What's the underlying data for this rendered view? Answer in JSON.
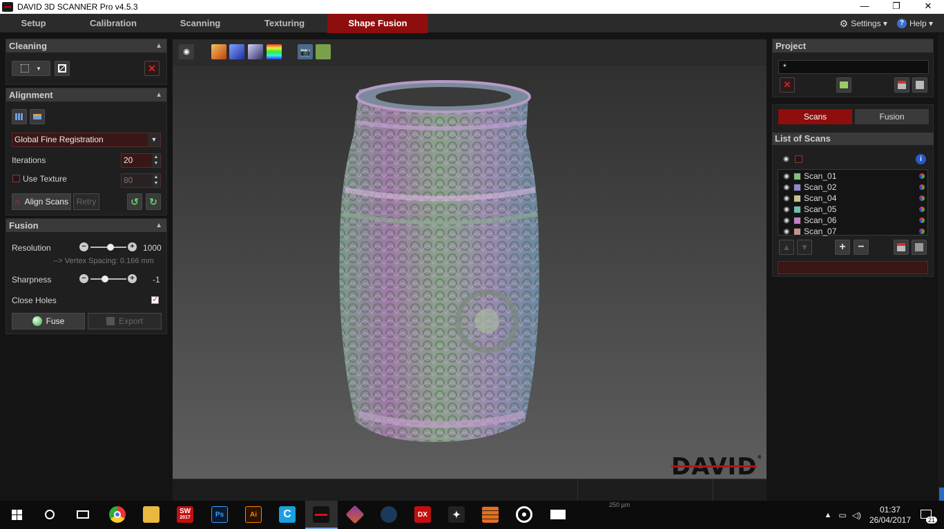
{
  "window": {
    "title": "DAVID 3D SCANNER Pro v4.5.3",
    "minimize": "—",
    "restore": "❐",
    "close": "✕"
  },
  "menu": {
    "tabs": [
      "Setup",
      "Calibration",
      "Scanning",
      "Texturing",
      "Shape Fusion"
    ],
    "active_tab": "Shape Fusion",
    "settings": "Settings ▾",
    "help": "Help ▾"
  },
  "cleaning": {
    "header": "Cleaning"
  },
  "alignment": {
    "header": "Alignment",
    "method": "Global Fine Registration",
    "iterations_label": "Iterations",
    "iterations_value": "20",
    "use_texture_label": "Use Texture",
    "use_texture_value": "80",
    "align_label": "Align Scans",
    "retry_label": "Retry"
  },
  "fusion": {
    "header": "Fusion",
    "resolution_label": "Resolution",
    "resolution_value": "1000",
    "resolution_level": 0.55,
    "vertex_spacing": "--> Vertex Spacing: 0.166 mm",
    "sharpness_label": "Sharpness",
    "sharpness_value": "-1",
    "sharpness_level": 0.4,
    "close_holes_label": "Close Holes",
    "close_holes_checked": true,
    "fuse_label": "Fuse",
    "export_label": "Export"
  },
  "viewport": {
    "logo": "DAVID",
    "logo_mark": "®",
    "scale": "250 µm"
  },
  "project": {
    "header": "Project",
    "name": "*"
  },
  "scans": {
    "tabs": [
      "Scans",
      "Fusion"
    ],
    "active_tab": "Scans",
    "list_header": "List of Scans",
    "items": [
      {
        "name": "Scan_01",
        "color": "#7fbf7f"
      },
      {
        "name": "Scan_02",
        "color": "#8a8ad0"
      },
      {
        "name": "Scan_04",
        "color": "#c8c28a"
      },
      {
        "name": "Scan_05",
        "color": "#6fbfb0"
      },
      {
        "name": "Scan_06",
        "color": "#c07fc8"
      },
      {
        "name": "Scan_07",
        "color": "#c8908a"
      }
    ]
  },
  "taskbar": {
    "apps": [
      "SW",
      "Ps",
      "Ai",
      "DX"
    ],
    "sw_year": "2017",
    "time": "01:37",
    "date": "26/04/2017",
    "notifications": "21"
  },
  "colors": {
    "accent": "#8e0e0e",
    "panel": "#1f1f1f"
  }
}
